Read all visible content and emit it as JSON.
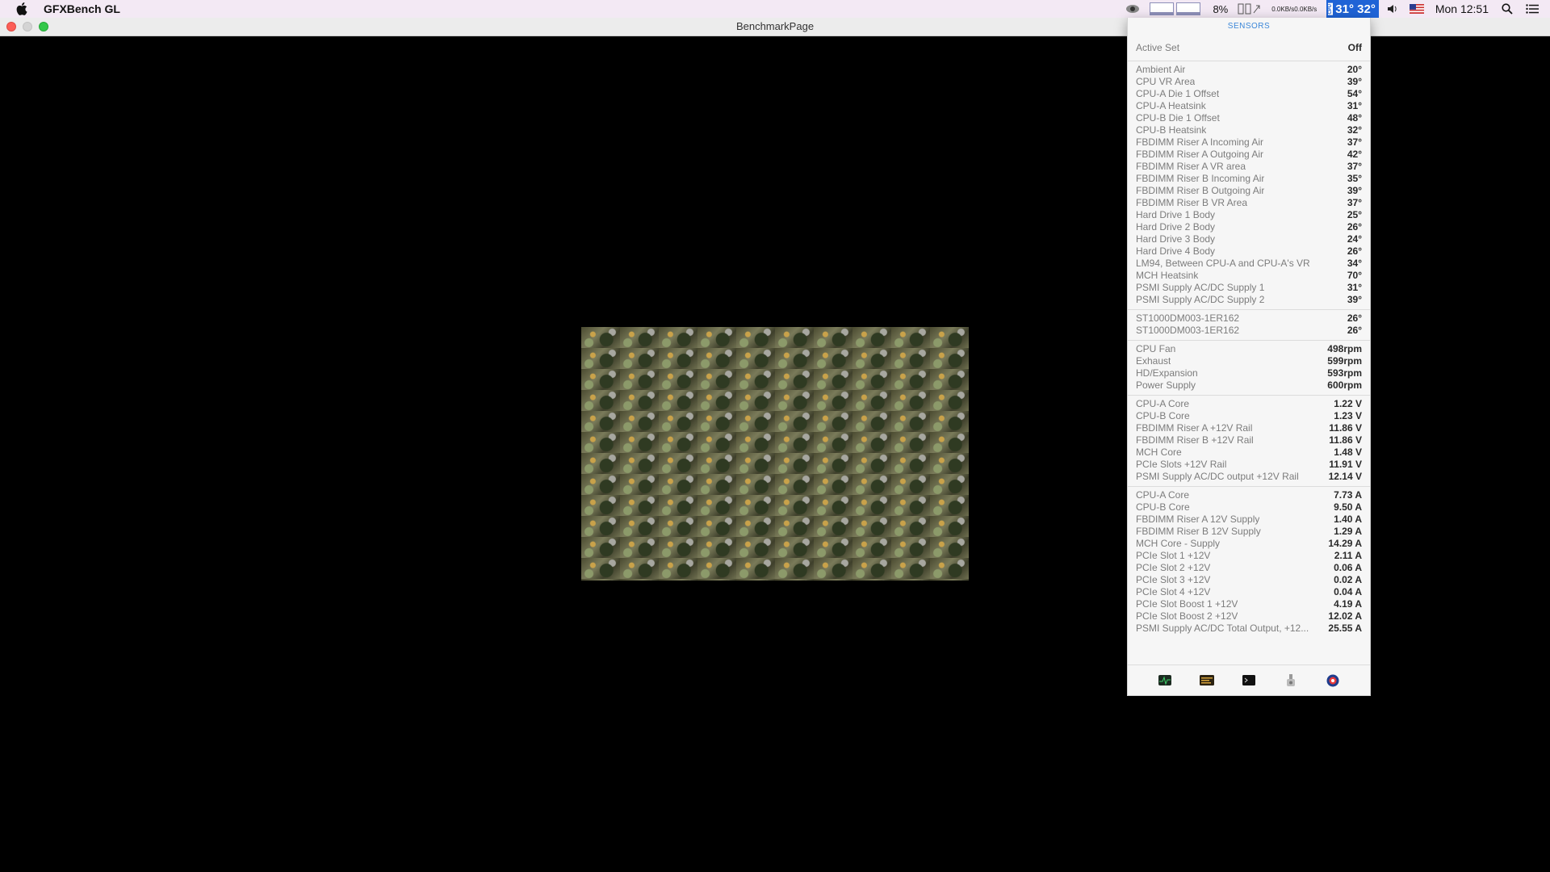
{
  "menubar": {
    "app_name": "GFXBench GL",
    "cpu_percent": "8%",
    "net_up": "0.0KB/s",
    "net_down": "0.0KB/s",
    "temp_label": "CPU",
    "temp_1": "31°",
    "temp_2": "32°",
    "clock": "Mon 12:51"
  },
  "window": {
    "title": "BenchmarkPage"
  },
  "sensors": {
    "header": "SENSORS",
    "active_set": {
      "label": "Active Set",
      "value": "Off"
    },
    "temperatures": [
      {
        "name": "Ambient Air",
        "value": "20°"
      },
      {
        "name": "CPU VR Area",
        "value": "39°"
      },
      {
        "name": "CPU-A Die 1 Offset",
        "value": "54°"
      },
      {
        "name": "CPU-A Heatsink",
        "value": "31°"
      },
      {
        "name": "CPU-B Die 1 Offset",
        "value": "48°"
      },
      {
        "name": "CPU-B Heatsink",
        "value": "32°"
      },
      {
        "name": "FBDIMM Riser A Incoming Air",
        "value": "37°"
      },
      {
        "name": "FBDIMM Riser A Outgoing Air",
        "value": "42°"
      },
      {
        "name": "FBDIMM Riser A VR area",
        "value": "37°"
      },
      {
        "name": "FBDIMM Riser B Incoming Air",
        "value": "35°"
      },
      {
        "name": "FBDIMM Riser B Outgoing Air",
        "value": "39°"
      },
      {
        "name": "FBDIMM Riser B VR Area",
        "value": "37°"
      },
      {
        "name": "Hard Drive 1 Body",
        "value": "25°"
      },
      {
        "name": "Hard Drive 2 Body",
        "value": "26°"
      },
      {
        "name": "Hard Drive 3 Body",
        "value": "24°"
      },
      {
        "name": "Hard Drive 4 Body",
        "value": "26°"
      },
      {
        "name": "LM94, Between CPU-A and CPU-A's VR",
        "value": "34°"
      },
      {
        "name": "MCH Heatsink",
        "value": "70°"
      },
      {
        "name": "PSMI Supply AC/DC Supply 1",
        "value": "31°"
      },
      {
        "name": "PSMI Supply AC/DC Supply 2",
        "value": "39°"
      }
    ],
    "drives": [
      {
        "name": "ST1000DM003-1ER162",
        "value": "26°"
      },
      {
        "name": "ST1000DM003-1ER162",
        "value": "26°"
      }
    ],
    "fans": [
      {
        "name": "CPU Fan",
        "value": "498rpm"
      },
      {
        "name": "Exhaust",
        "value": "599rpm"
      },
      {
        "name": "HD/Expansion",
        "value": "593rpm"
      },
      {
        "name": "Power Supply",
        "value": "600rpm"
      }
    ],
    "voltages": [
      {
        "name": "CPU-A Core",
        "value": "1.22 V"
      },
      {
        "name": "CPU-B Core",
        "value": "1.23 V"
      },
      {
        "name": "FBDIMM Riser A +12V Rail",
        "value": "11.86 V"
      },
      {
        "name": "FBDIMM Riser B +12V Rail",
        "value": "11.86 V"
      },
      {
        "name": "MCH Core",
        "value": "1.48 V"
      },
      {
        "name": "PCIe Slots +12V Rail",
        "value": "11.91 V"
      },
      {
        "name": "PSMI Supply AC/DC output +12V Rail",
        "value": "12.14 V"
      }
    ],
    "currents": [
      {
        "name": "CPU-A Core",
        "value": "7.73 A"
      },
      {
        "name": "CPU-B Core",
        "value": "9.50 A"
      },
      {
        "name": "FBDIMM Riser A 12V Supply",
        "value": "1.40 A"
      },
      {
        "name": "FBDIMM Riser B 12V Supply",
        "value": "1.29 A"
      },
      {
        "name": "MCH Core - Supply",
        "value": "14.29 A"
      },
      {
        "name": "PCIe Slot 1 +12V",
        "value": "2.11 A"
      },
      {
        "name": "PCIe Slot 2 +12V",
        "value": "0.06 A"
      },
      {
        "name": "PCIe Slot 3 +12V",
        "value": "0.02 A"
      },
      {
        "name": "PCIe Slot 4 +12V",
        "value": "0.04 A"
      },
      {
        "name": "PCIe Slot Boost 1 +12V",
        "value": "4.19 A"
      },
      {
        "name": "PCIe Slot Boost 2 +12V",
        "value": "12.02 A"
      },
      {
        "name": "PSMI Supply AC/DC Total Output, +12...",
        "value": "25.55 A"
      }
    ]
  },
  "colors": {
    "accent": "#1f63d6",
    "sensor_header": "#3b86d8"
  }
}
